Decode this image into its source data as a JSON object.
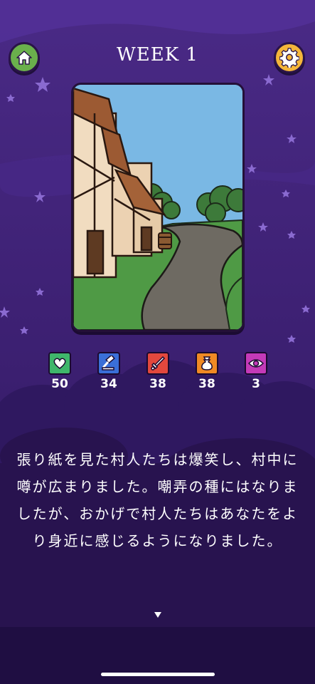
{
  "header": {
    "title": "WEEK 1",
    "home_icon": "home-icon",
    "settings_icon": "gear-icon"
  },
  "card": {
    "scene": "village-street-illustration"
  },
  "stats": [
    {
      "name": "heart",
      "icon": "heart-icon",
      "color": "#3fb66b",
      "value": "50"
    },
    {
      "name": "law",
      "icon": "gavel-icon",
      "color": "#3a6fd8",
      "value": "34"
    },
    {
      "name": "military",
      "icon": "sword-icon",
      "color": "#e2483d",
      "value": "38"
    },
    {
      "name": "wealth",
      "icon": "money-bag-icon",
      "color": "#f08a24",
      "value": "38"
    },
    {
      "name": "mystery",
      "icon": "eye-icon",
      "color": "#c43ab8",
      "value": "3"
    }
  ],
  "message": {
    "text": "張り紙を見た村人たちは爆笑し、村中に噂が広まりました。嘲弄の種にはなりましたが、おかげで村人たちはあなたをより身近に感じるようになりました。"
  },
  "colors": {
    "background": "#3a1f6e",
    "accent_green": "#6ab04c",
    "accent_gold": "#f4b63a"
  }
}
